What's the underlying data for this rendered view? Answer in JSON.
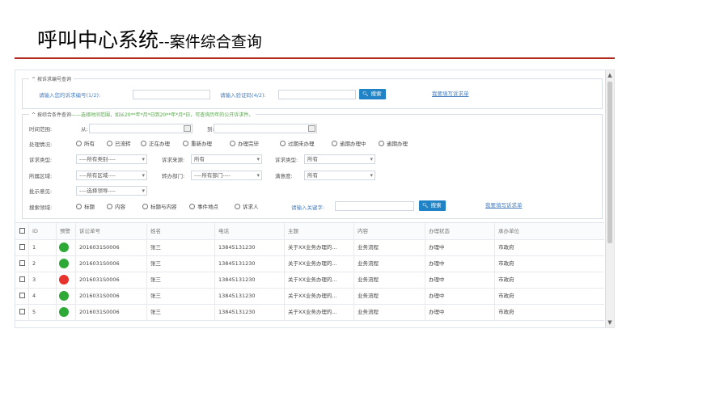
{
  "slide": {
    "title_main": "呼叫中心系统",
    "title_sub": "--案件综合查询"
  },
  "colors": {
    "accent_rule": "#b02a22",
    "primary_button": "#1f83c5",
    "warn_green": "#2ea836",
    "warn_red": "#e8322e"
  },
  "search_by_number": {
    "legend": "按诉求编号查询",
    "number_label": "请输入您的诉求编号(1/2):",
    "number_value": "",
    "code_label": "请输入验证码(4/2):",
    "code_value": "",
    "search_button": "搜索",
    "help_link": "我要填写诉求单"
  },
  "search_combined": {
    "legend": "按综合条件查询",
    "legend_hint": "——选择时间范围，如从20**年*月*日到20**年*月*日，可查询历年的公开诉求件。",
    "time_label": "时间范围:",
    "from_label": "从:",
    "from_value": "",
    "to_label": "到:",
    "to_value": "",
    "status_label": "处理情况:",
    "status_options": [
      "所有",
      "已流转",
      "正在办理",
      "重新办理",
      "办理完毕",
      "过期未办理",
      "逾期办理中",
      "逾期办理"
    ],
    "appeal_type_label": "诉求类型:",
    "appeal_type_value": "----所有类别----",
    "source_label": "诉求来源:",
    "source_value": "所有",
    "appeal_type2_label": "诉求类型:",
    "appeal_type2_value": "所有",
    "region_label": "所属区域:",
    "region_value": "----所有区域----",
    "transfer_dept_label": "转办部门:",
    "transfer_dept_value": "----所有部门----",
    "satisfaction_label": "满意度:",
    "satisfaction_value": "所有",
    "instruction_label": "批示意见:",
    "instruction_value": "----选择领导----",
    "scope_label": "搜索领域:",
    "scope_options": [
      "标题",
      "内容",
      "标题与内容",
      "事件地点",
      "诉求人"
    ],
    "keyword_label": "请输入关键字:",
    "keyword_value": "",
    "search_button": "搜索",
    "help_link": "我要填写诉求单"
  },
  "table": {
    "columns": [
      "ID",
      "预警",
      "诉讼单号",
      "姓名",
      "电话",
      "主题",
      "内容",
      "办理状态",
      "承办单位"
    ],
    "rows": [
      {
        "id": "1",
        "warn": "green",
        "no": "2016031S0006",
        "name": "张三",
        "phone": "13845131230",
        "subject": "关于XX业务办理的...",
        "content": "业务流程",
        "status": "办理中",
        "unit": "市政府"
      },
      {
        "id": "2",
        "warn": "green",
        "no": "2016031S0006",
        "name": "张三",
        "phone": "13845131230",
        "subject": "关于XX业务办理的...",
        "content": "业务流程",
        "status": "办理中",
        "unit": "市政府"
      },
      {
        "id": "3",
        "warn": "red",
        "no": "2016031S0006",
        "name": "张三",
        "phone": "13845131230",
        "subject": "关于XX业务办理的...",
        "content": "业务流程",
        "status": "办理中",
        "unit": "市政府"
      },
      {
        "id": "4",
        "warn": "green",
        "no": "2016031S0006",
        "name": "张三",
        "phone": "13845131230",
        "subject": "关于XX业务办理的...",
        "content": "业务流程",
        "status": "办理中",
        "unit": "市政府"
      },
      {
        "id": "5",
        "warn": "green",
        "no": "2016031S0006",
        "name": "张三",
        "phone": "13845131230",
        "subject": "关于XX业务办理的...",
        "content": "业务流程",
        "status": "办理中",
        "unit": "市政府"
      }
    ]
  }
}
